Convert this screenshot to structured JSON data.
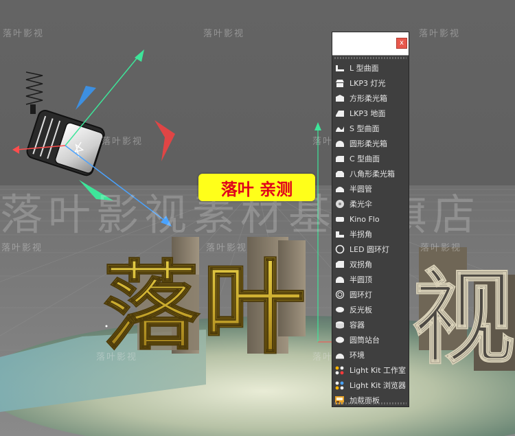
{
  "badge_text": "落叶 亲测",
  "watermark_small": "落叶影视",
  "watermark_big": "落叶影视素材基地旗店",
  "scene_letters": [
    "落",
    "叶",
    "视"
  ],
  "colors": {
    "badge_bg": "#ffff1a",
    "badge_text": "#e0001b",
    "close_button": "#e8584c",
    "menu_bg": "#3f3f3f"
  },
  "menu": {
    "search_placeholder": "",
    "close_label": "x",
    "items": [
      {
        "label": "L 型曲面",
        "icon": "l-surface-icon"
      },
      {
        "label": "LKP3 灯光",
        "icon": "lkp3-light-icon"
      },
      {
        "label": "方形柔光箱",
        "icon": "square-softbox-icon"
      },
      {
        "label": "LKP3 地面",
        "icon": "lkp3-floor-icon"
      },
      {
        "label": "S 型曲面",
        "icon": "s-surface-icon"
      },
      {
        "label": "圆形柔光箱",
        "icon": "round-softbox-icon"
      },
      {
        "label": "C 型曲面",
        "icon": "c-surface-icon"
      },
      {
        "label": "八角形柔光箱",
        "icon": "octagon-softbox-icon"
      },
      {
        "label": "半圆管",
        "icon": "half-tube-icon"
      },
      {
        "label": "柔光伞",
        "icon": "umbrella-icon"
      },
      {
        "label": "Kino Flo",
        "icon": "kino-flo-icon"
      },
      {
        "label": "半拐角",
        "icon": "half-corner-icon"
      },
      {
        "label": "LED 圆环灯",
        "icon": "led-ring-icon"
      },
      {
        "label": "双拐角",
        "icon": "double-corner-icon"
      },
      {
        "label": "半圆顶",
        "icon": "half-dome-icon"
      },
      {
        "label": "圆环灯",
        "icon": "ring-light-icon"
      },
      {
        "label": "反光板",
        "icon": "reflector-icon"
      },
      {
        "label": "容器",
        "icon": "container-icon"
      },
      {
        "label": "圆筒站台",
        "icon": "cylinder-stage-icon"
      },
      {
        "label": "环境",
        "icon": "environment-icon"
      },
      {
        "label": "Light Kit 工作室",
        "icon": "light-kit-studio-icon"
      },
      {
        "label": "Light Kit 浏览器",
        "icon": "light-kit-browser-icon"
      },
      {
        "label": "加载面板",
        "icon": "load-panel-icon"
      }
    ]
  }
}
